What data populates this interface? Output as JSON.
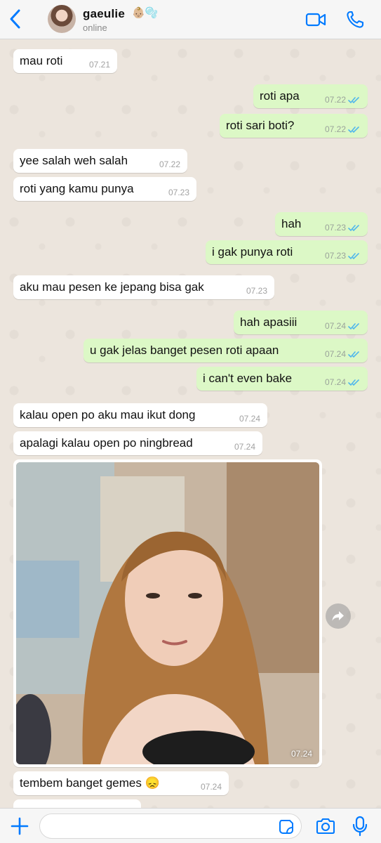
{
  "header": {
    "contact_name": "gaeulie",
    "contact_emoji": "👶🏼🫧",
    "status": "online"
  },
  "messages": [
    {
      "dir": "in",
      "text": "mau roti",
      "time": "07.21"
    },
    {
      "dir": "out",
      "text": "roti apa",
      "time": "07.22"
    },
    {
      "dir": "out",
      "text": "roti sari boti?",
      "time": "07.22"
    },
    {
      "dir": "in",
      "text": "yee salah weh salah",
      "time": "07.22"
    },
    {
      "dir": "in",
      "text": "roti yang kamu punya",
      "time": "07.23"
    },
    {
      "dir": "out",
      "text": "hah",
      "time": "07.23"
    },
    {
      "dir": "out",
      "text": "i gak punya roti",
      "time": "07.23"
    },
    {
      "dir": "in",
      "text": "aku mau pesen ke jepang bisa gak",
      "time": "07.23"
    },
    {
      "dir": "out",
      "text": "hah apasiii",
      "time": "07.24"
    },
    {
      "dir": "out",
      "text": "u gak jelas banget pesen roti apaan",
      "time": "07.24"
    },
    {
      "dir": "out",
      "text": "i can't even bake",
      "time": "07.24"
    },
    {
      "dir": "in",
      "text": "kalau open po aku mau ikut dong",
      "time": "07.24"
    },
    {
      "dir": "in",
      "text": "apalagi kalau open po ningbread",
      "time": "07.24"
    },
    {
      "dir": "in",
      "text": "tembem banget gemes 😞",
      "time": "07.24"
    }
  ],
  "photo": {
    "time": "07.24"
  },
  "composer": {
    "placeholder": ""
  },
  "colors": {
    "accent": "#007aff",
    "incoming_bubble": "#ffffff",
    "outgoing_bubble": "#dcf8c6",
    "read_ticks": "#4fb6ec",
    "chat_background": "#ece5dd"
  }
}
